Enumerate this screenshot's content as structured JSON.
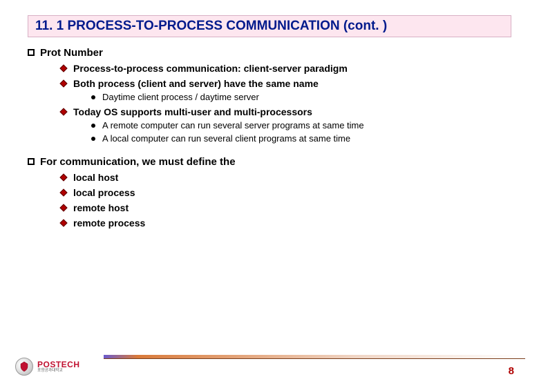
{
  "title": "11. 1 PROCESS-TO-PROCESS COMMUNICATION (cont. )",
  "sections": {
    "s1": {
      "heading": "Prot Number",
      "items": {
        "i1": "Process-to-process communication: client-server paradigm",
        "i2": "Both process (client and server) have the same name",
        "i2_sub": {
          "a": "Daytime client process / daytime server"
        },
        "i3": "Today OS supports multi-user and multi-processors",
        "i3_sub": {
          "a": "A remote computer can run several server programs at same time",
          "b": "A local computer can run several client programs at same time"
        }
      }
    },
    "s2": {
      "heading": "For communication, we must define the",
      "items": {
        "i1": "local host",
        "i2": "local process",
        "i3": "remote host",
        "i4": "remote process"
      }
    }
  },
  "logo": {
    "name": "POSTECH",
    "sub": "포항공과대학교"
  },
  "page": "8"
}
